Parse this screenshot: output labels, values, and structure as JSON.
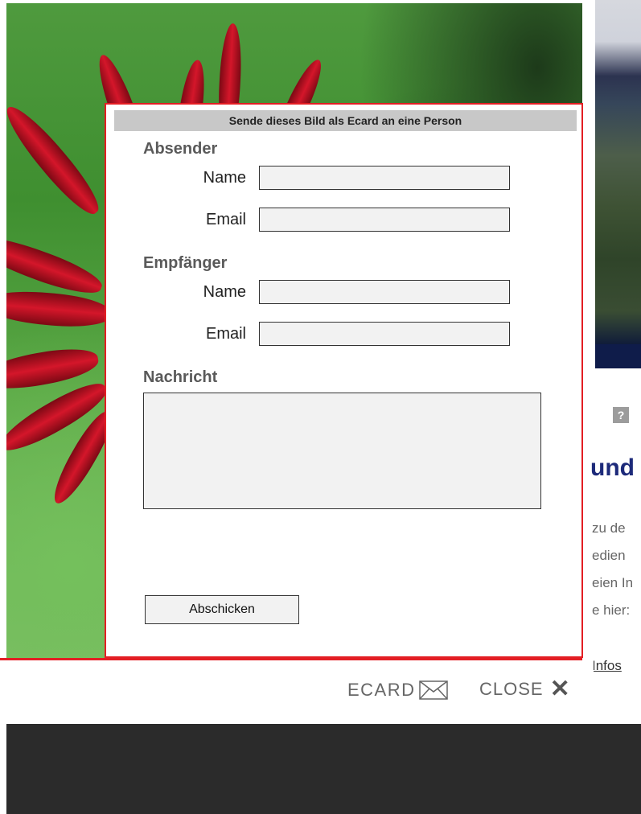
{
  "dialog": {
    "title": "Sende dieses Bild als Ecard an eine Person",
    "sender_heading": "Absender",
    "recipient_heading": "Empfänger",
    "message_heading": "Nachricht",
    "name_label": "Name",
    "email_label": "Email",
    "sender_name_value": "",
    "sender_email_value": "",
    "recipient_name_value": "",
    "recipient_email_value": "",
    "message_value": "",
    "submit_label": "Abschicken"
  },
  "controls": {
    "ecard_label": "ECARD",
    "close_label": "CLOSE",
    "ecard_icon": "envelope-icon",
    "close_icon": "close-icon"
  },
  "background_page": {
    "help_icon_text": "?",
    "heading_fragment": "und",
    "text_lines": [
      "zu de",
      "edien",
      "eien In",
      "e hier:"
    ],
    "link_fragment": "Infos"
  },
  "colors": {
    "accent_red": "#e31e24",
    "title_bar": "#c8c8c8",
    "field_bg": "#f2f2f2",
    "overlay": "#2b2b2b"
  }
}
